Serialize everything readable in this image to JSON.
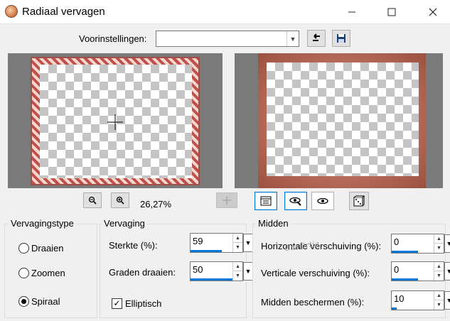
{
  "window": {
    "title": "Radiaal vervagen",
    "minimize_icon": "minimize-icon",
    "maximize_icon": "maximize-icon",
    "close_icon": "close-icon"
  },
  "presets": {
    "label": "Voorinstellingen:",
    "value": ""
  },
  "preview": {
    "zoom": "26,27%"
  },
  "fade_type": {
    "title": "Vervagingstype",
    "options": [
      {
        "label": "Draaien",
        "checked": false
      },
      {
        "label": "Zoomen",
        "checked": false
      },
      {
        "label": "Spiraal",
        "checked": true
      }
    ]
  },
  "blur": {
    "title": "Vervaging",
    "strength_label": "Sterkte (%):",
    "strength_value": "59",
    "rotate_label": "Graden draaien:",
    "rotate_value": "50",
    "elliptical_label": "Elliptisch",
    "elliptical_checked": true
  },
  "center": {
    "title": "Midden",
    "hshift_label": "Horizontale verschuiving (%):",
    "hshift_value": "0",
    "vshift_label": "Verticale verschuiving (%):",
    "vshift_value": "0",
    "protect_label": "Midden beschermen (%):",
    "protect_value": "10"
  },
  "watermark": "CasOrtia"
}
